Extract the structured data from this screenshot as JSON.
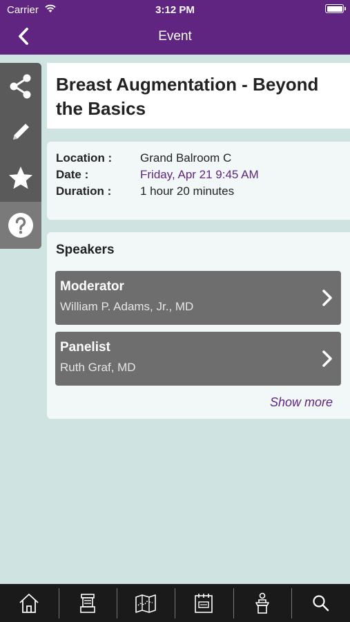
{
  "status_bar": {
    "carrier": "Carrier",
    "time": "3:12 PM"
  },
  "nav": {
    "title": "Event",
    "back_icon": "chevron-left-icon"
  },
  "side_toolbar": [
    {
      "icon": "share-icon"
    },
    {
      "icon": "pencil-icon"
    },
    {
      "icon": "star-icon"
    },
    {
      "icon": "help-icon"
    }
  ],
  "event": {
    "title": "Breast Augmentation - Beyond the Basics",
    "location_label": "Location :",
    "location": "Grand Balroom C",
    "date_label": "Date :",
    "date": "Friday, Apr 21 9:45 AM",
    "duration_label": "Duration :",
    "duration": "1 hour 20 minutes"
  },
  "speakers": {
    "heading": "Speakers",
    "items": [
      {
        "role": "Moderator",
        "name": "William P. Adams, Jr., MD"
      },
      {
        "role": "Panelist",
        "name": "Ruth Graf, MD"
      }
    ],
    "show_more": "Show more"
  },
  "tab_bar": [
    {
      "icon": "home-icon"
    },
    {
      "icon": "exhibitor-booth-icon"
    },
    {
      "icon": "map-icon"
    },
    {
      "icon": "schedule-icon"
    },
    {
      "icon": "speaker-podium-icon"
    },
    {
      "icon": "search-icon"
    }
  ],
  "colors": {
    "header": "#5f2580",
    "accent": "#5f2580",
    "background": "#cfe3e1",
    "toolbar": "#5a5a5a",
    "speaker_row": "#6e6e6e",
    "tab_bar": "#1a1a1a"
  }
}
